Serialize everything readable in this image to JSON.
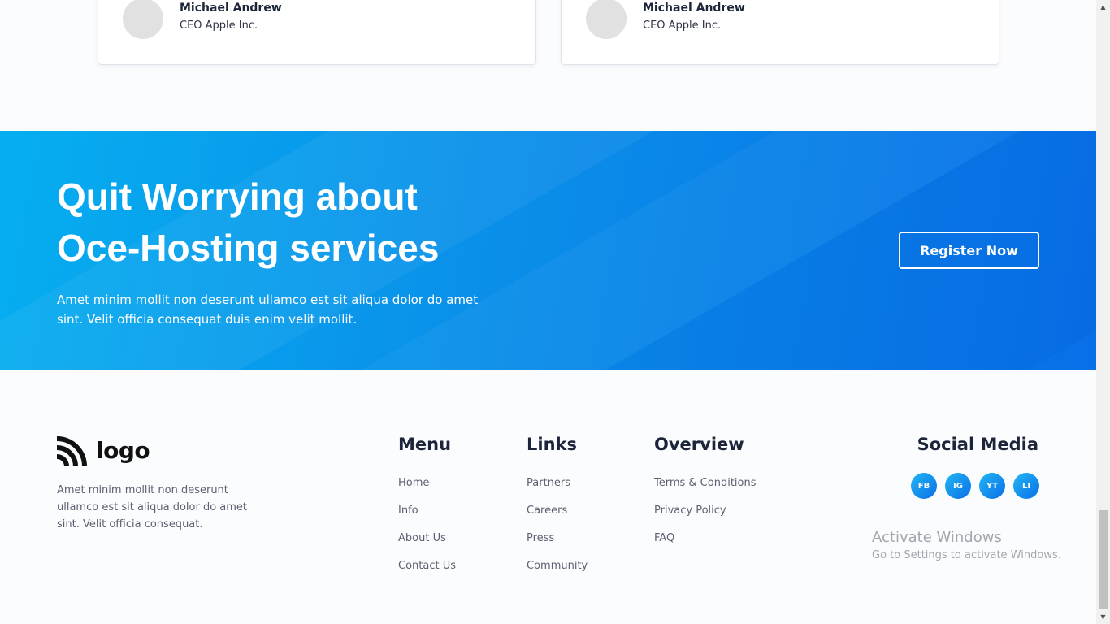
{
  "testimonials": [
    {
      "name": "Michael Andrew",
      "role": "CEO Apple Inc."
    },
    {
      "name": "Michael Andrew",
      "role": "CEO Apple Inc."
    }
  ],
  "cta": {
    "title_line1": "Quit Worrying about",
    "title_line2": "Oce-Hosting services",
    "text": "Amet minim mollit non deserunt ullamco est sit aliqua dolor do amet sint. Velit officia consequat duis enim velit mollit.",
    "button_label": "Register Now",
    "colors": {
      "gradient_start": "#06aef0",
      "gradient_end": "#086fe8"
    }
  },
  "footer": {
    "logo_text": "logo",
    "about": "Amet minim mollit non deserunt ullamco est sit aliqua dolor do amet sint. Velit officia consequat.",
    "menu": {
      "title": "Menu",
      "items": [
        "Home",
        "Info",
        "About Us",
        "Contact Us"
      ]
    },
    "links": {
      "title": "Links",
      "items": [
        "Partners",
        "Careers",
        "Press",
        "Community"
      ]
    },
    "overview": {
      "title": "Overview",
      "items": [
        "Terms & Conditions",
        "Privacy Policy",
        "FAQ"
      ]
    },
    "social": {
      "title": "Social Media",
      "icons": [
        {
          "label": "FB",
          "icon": "facebook-icon"
        },
        {
          "label": "IG",
          "icon": "instagram-icon"
        },
        {
          "label": "YT",
          "icon": "youtube-icon"
        },
        {
          "label": "LI",
          "icon": "linkedin-icon"
        }
      ]
    }
  },
  "watermark": {
    "title": "Activate Windows",
    "subtitle": "Go to Settings to activate Windows."
  }
}
